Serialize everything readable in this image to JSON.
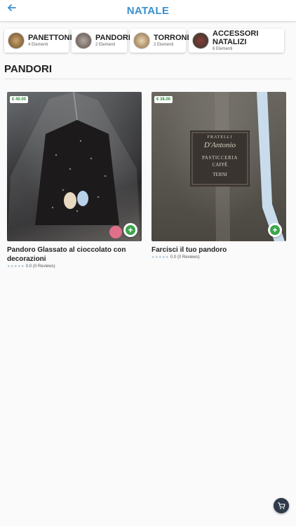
{
  "header": {
    "title": "NATALE",
    "back_icon": "arrow-left-icon"
  },
  "categories": [
    {
      "name": "PANETTONI",
      "count": "4 Elementi"
    },
    {
      "name": "PANDORI",
      "count": "2 Elementi"
    },
    {
      "name": "TORRONI",
      "count": "2 Elementi"
    },
    {
      "name": "ACCESSORI NATALIZI",
      "count": "6 Elementi"
    }
  ],
  "section": {
    "title": "PANDORI"
  },
  "products": [
    {
      "price": "€ 40.00",
      "name": "Pandoro Glassato al cioccolato con decorazioni",
      "rating": "0.0 (0 Reviews)"
    },
    {
      "price": "€ 38.00",
      "name": "Farcisci il tuo pandoro",
      "rating": "0.0 (0 Reviews)",
      "label_lines": [
        "FRATELLI",
        "D'Antonio",
        "PASTICCERIA",
        "CAFFÈ",
        "TERNI"
      ]
    }
  ],
  "colors": {
    "accent": "#3a8fcf",
    "add_button": "#3aa54a",
    "cart": "#2f3b4a",
    "price": "#2e8b3e"
  },
  "cart": {
    "icon": "cart-icon"
  }
}
